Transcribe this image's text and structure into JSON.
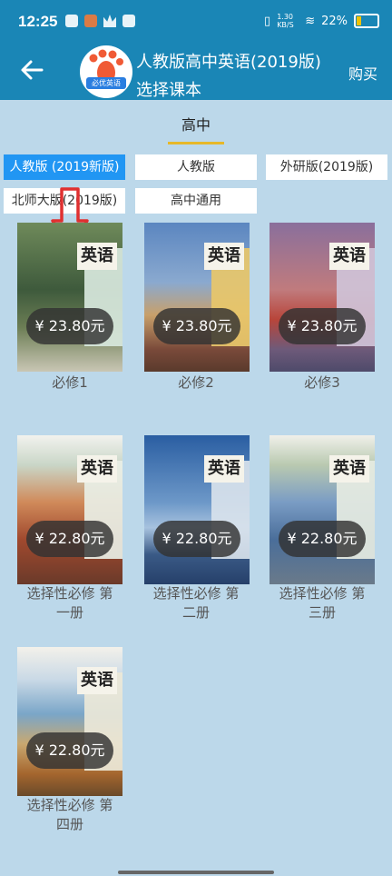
{
  "status_bar": {
    "time": "12:25",
    "speed": "1.30 KB/S",
    "battery": "22%"
  },
  "header": {
    "title": "人教版高中英语(2019版)",
    "subtitle": "选择课本",
    "buy_label": "购买",
    "logo_text": "必优英语"
  },
  "stage": {
    "label": "高中"
  },
  "versions": [
    {
      "label": "人教版 (2019新版)",
      "active": true
    },
    {
      "label": "人教版",
      "active": false
    },
    {
      "label": "外研版(2019版)",
      "active": false
    },
    {
      "label": "北师大版(2019版)",
      "active": false
    },
    {
      "label": "高中通用",
      "active": false
    }
  ],
  "books": [
    {
      "title": "英语",
      "price": "¥ 23.80元",
      "label_lines": [
        "必修1"
      ]
    },
    {
      "title": "英语",
      "price": "¥ 23.80元",
      "label_lines": [
        "必修2"
      ]
    },
    {
      "title": "英语",
      "price": "¥ 23.80元",
      "label_lines": [
        "必修3"
      ]
    },
    {
      "title": "英语",
      "price": "¥ 22.80元",
      "label_lines": [
        "选择性必修 第",
        "一册"
      ]
    },
    {
      "title": "英语",
      "price": "¥ 22.80元",
      "label_lines": [
        "选择性必修 第",
        "二册"
      ]
    },
    {
      "title": "英语",
      "price": "¥ 22.80元",
      "label_lines": [
        "选择性必修 第",
        "三册"
      ]
    },
    {
      "title": "英语",
      "price": "¥ 22.80元",
      "label_lines": [
        "选择性必修 第",
        "四册"
      ]
    }
  ],
  "colors": {
    "primary": "#1a86b6",
    "accent": "#e7b829",
    "annotation": "#e03030"
  }
}
